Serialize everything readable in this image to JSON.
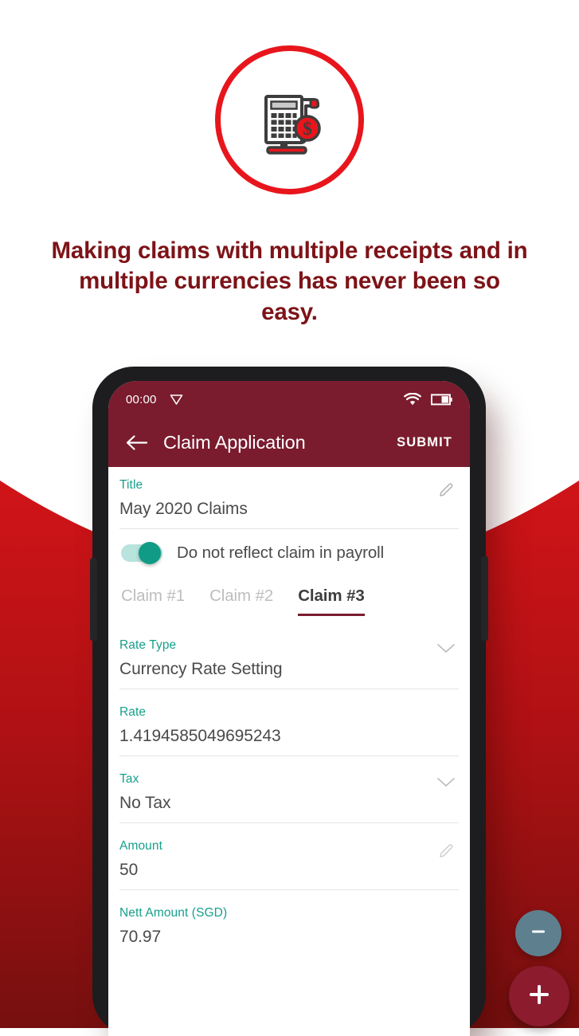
{
  "colors": {
    "brand_red": "#e8151c",
    "maroon": "#7a1c2e",
    "heading_maroon": "#7d1318",
    "teal_label": "#17a08c",
    "toggle_on": "#0f9b85",
    "fab_minus": "#5d7f8e",
    "fab_plus": "#8c1b2d",
    "backdrop_top": "#cc1418",
    "backdrop_bottom": "#76100f"
  },
  "hero": {
    "badge_icon": "receipt-calculator-dollar-icon",
    "headline": "Making claims with multiple receipts and in multiple currencies has never been so easy."
  },
  "phone": {
    "statusbar": {
      "time": "00:00",
      "cast_icon": "cast-triangle-icon",
      "wifi_icon": "wifi-icon",
      "battery_icon": "battery-icon"
    },
    "appbar": {
      "back_icon": "arrow-left-icon",
      "title": "Claim Application",
      "submit_label": "SUBMIT"
    },
    "form": {
      "title_field": {
        "label": "Title",
        "value": "May 2020 Claims",
        "icon": "pencil-edit-icon"
      },
      "payroll_toggle": {
        "label": "Do not reflect claim in payroll",
        "state": "on"
      },
      "tabs": [
        {
          "label": "Claim #1",
          "active": false
        },
        {
          "label": "Claim #2",
          "active": false
        },
        {
          "label": "Claim #3",
          "active": true
        }
      ],
      "rate_type_field": {
        "label": "Rate Type",
        "value": "Currency Rate Setting",
        "icon": "chevron-down-icon"
      },
      "rate_field": {
        "label": "Rate",
        "value": "1.4194585049695243"
      },
      "tax_field": {
        "label": "Tax",
        "value": "No Tax",
        "icon": "chevron-down-icon"
      },
      "amount_field": {
        "label": "Amount",
        "value": "50",
        "icon": "pencil-edit-icon"
      },
      "nett_amount_field": {
        "label": "Nett Amount (SGD)",
        "value": "70.97"
      }
    },
    "fabs": {
      "minus_icon": "minus-icon",
      "plus_icon": "plus-icon"
    }
  }
}
